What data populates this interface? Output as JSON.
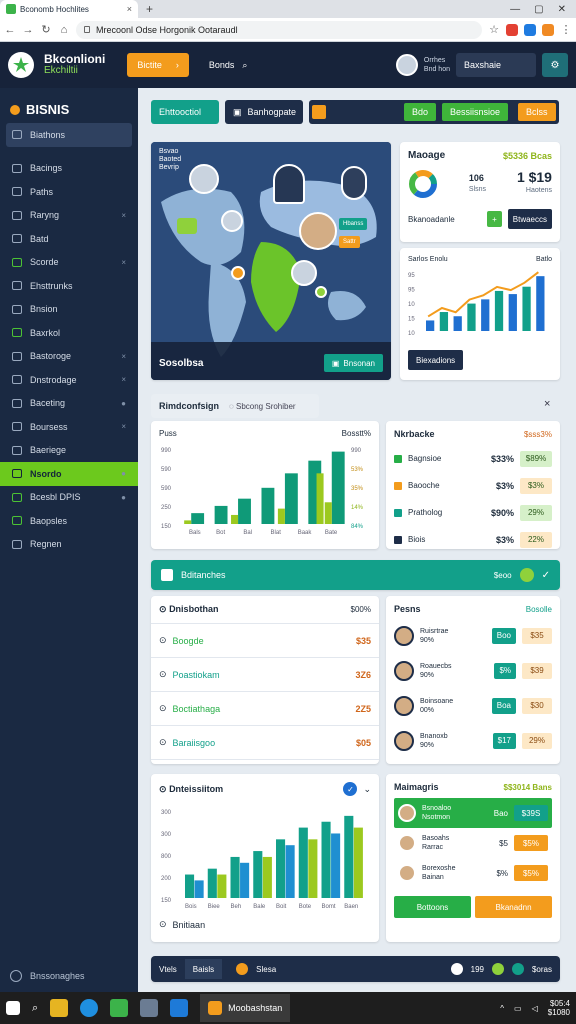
{
  "browser": {
    "tab_title": "Bconomb Hochlites",
    "url": "Mrecoonl Odse Horgonik Ootaraudl",
    "controls": [
      "—",
      "▢",
      "✕"
    ]
  },
  "appbar": {
    "brand_line1": "Bkconlioni",
    "brand_line2": "Ekchiltii",
    "orange_button": "Bictite",
    "nav_link": "Bonds",
    "profile_top": "Orrhes",
    "profile_bottom": "Bnd hon",
    "profile_box": "Baxshaie"
  },
  "sidebar": {
    "header": "BISNIS",
    "items": [
      {
        "label": "Biathons",
        "tail": ""
      },
      {
        "label": "Bacings",
        "tail": ""
      },
      {
        "label": "Paths",
        "tail": ""
      },
      {
        "label": "Raryng",
        "tail": "×"
      },
      {
        "label": "Batd",
        "tail": ""
      },
      {
        "label": "Scorde",
        "tail": "×"
      },
      {
        "label": "Ehsttrunks",
        "tail": ""
      },
      {
        "label": "Bnsion",
        "tail": ""
      },
      {
        "label": "Baxrkol",
        "tail": ""
      },
      {
        "label": "Bastoroge",
        "tail": "×"
      },
      {
        "label": "Dnstrodage",
        "tail": "×"
      },
      {
        "label": "Baceting",
        "tail": "●"
      },
      {
        "label": "Boursess",
        "tail": "×"
      },
      {
        "label": "Baeriege",
        "tail": ""
      },
      {
        "label": "Nsordo",
        "tail": "●"
      },
      {
        "label": "Bcesbl DPIS",
        "tail": "●"
      },
      {
        "label": "Baopsles",
        "tail": ""
      },
      {
        "label": "Regnen",
        "tail": ""
      }
    ],
    "footer": "Bnssonaghes"
  },
  "toolbar": {
    "chip1": "Ehttooctiol",
    "chip2": "Banhogpate",
    "chip3": "Bdo",
    "chip4": "Bessiisnsioe",
    "chip5": "Bclss"
  },
  "map": {
    "top_label_lines": [
      "Bsvao",
      "Baoted",
      "Bevrip"
    ],
    "bottom_label": "Sosolbsa",
    "bottom_button": "Bnsonan",
    "marker_badges": [
      "Hbanss",
      "Sattr"
    ]
  },
  "manage": {
    "title": "Maoage",
    "value": "$5336 Bcas",
    "donut_label1": "106",
    "donut_label2": "Slsns",
    "big_value": "1 $19",
    "big_sub": "Haotens",
    "footer_left": "Bkanoadanle",
    "footer_button": "Btwaeccs",
    "colors": {
      "blue": "#1f6fd1",
      "green": "#47b844",
      "orange": "#f39c1d",
      "teal": "#12a08a"
    }
  },
  "trend": {
    "title": "Sarlos Enolu",
    "right": "Batlo",
    "button": "Biexadions",
    "y_ticks": [
      "95",
      "95",
      "10",
      "15",
      "10"
    ]
  },
  "section": {
    "title": "Rimdconfsign",
    "pill": "Sbcong Srohiber"
  },
  "chart_data": [
    {
      "type": "bar",
      "title": "Puss",
      "value_label": "Bosstt%",
      "categories": [
        "Bals",
        "Bot",
        "Bal",
        "Blat",
        "Baak",
        "Bate"
      ],
      "series": [
        {
          "values": [
            6,
            10,
            14,
            20,
            28,
            35,
            40
          ]
        },
        {
          "values": [
            4,
            7,
            10,
            13,
            17,
            21,
            24
          ]
        }
      ],
      "y_ticks_left": [
        "990",
        "590",
        "590",
        "250",
        "150"
      ],
      "y_ticks_right": [
        "990",
        "53%",
        "35%",
        "14%",
        "84%"
      ]
    },
    {
      "type": "bar",
      "title": "Dnteissiitom",
      "categories": [
        "Bois",
        "Biee",
        "Beh",
        "Bale",
        "Boit",
        "Bote",
        "Bomt",
        "Baen"
      ],
      "series": [
        {
          "values": [
            4,
            5,
            7,
            8,
            10,
            12,
            13,
            14
          ]
        },
        {
          "values": [
            3,
            4,
            6,
            7,
            9,
            10,
            11,
            12
          ]
        }
      ],
      "y_ticks": [
        "300",
        "300",
        "800",
        "200",
        "150"
      ],
      "footer": "Bnitiaan"
    },
    {
      "type": "line",
      "title": "Sarlos Enolu",
      "series": [
        {
          "values": [
            10,
            18,
            14,
            26,
            30,
            38,
            35,
            42,
            52
          ]
        }
      ]
    }
  ],
  "metrics": {
    "title": "Nkrbacke",
    "header_right": "$sss3%",
    "rows": [
      {
        "label": "Bagnsioe",
        "v1": "$33%",
        "v2": "$89%"
      },
      {
        "label": "Baooche",
        "v1": "$3%",
        "v2": "$3%"
      },
      {
        "label": "Pratholog",
        "v1": "$90%",
        "v2": "29%"
      },
      {
        "label": "Biois",
        "v1": "$3%",
        "v2": "22%"
      }
    ]
  },
  "banner": {
    "label": "Bditanches",
    "right": "$eoo"
  },
  "list_left": {
    "title": "Dnisbothan",
    "right": "$00%",
    "rows": [
      {
        "label": "Boogde",
        "value": "$35"
      },
      {
        "label": "Poastiokam",
        "value": "3Z6"
      },
      {
        "label": "Boctiathaga",
        "value": "2Z5"
      },
      {
        "label": "Baraiisgoo",
        "value": "$05"
      }
    ]
  },
  "people": {
    "title": "Pesns",
    "right": "Bosolle",
    "rows": [
      {
        "name": "Ruisrtrae",
        "sub": "90%",
        "v1": "Boo",
        "v2": "$35"
      },
      {
        "name": "Roauecbs",
        "sub": "90%",
        "v1": "$%",
        "v2": "$39"
      },
      {
        "name": "Boinsoane",
        "sub": "00%",
        "v1": "Boa",
        "v2": "$30"
      },
      {
        "name": "Bnanoxb",
        "sub": "90%",
        "v1": "$17",
        "v2": "29%"
      }
    ]
  },
  "managers": {
    "title": "Maimagris",
    "value": "$$3014 Bans",
    "rows": [
      {
        "name": "Bsnoaloo",
        "sub": "Nsotmon",
        "v1": "Bao",
        "v2": "$39S"
      },
      {
        "name": "Basoahs",
        "sub": "Rarrac",
        "v1": "$5",
        "v2": "$5%"
      },
      {
        "name": "Borexoshe",
        "sub": "Bainan",
        "v1": "$%",
        "v2": "$5%"
      }
    ],
    "btn1": "Bottoons",
    "btn2": "Bkanadnn"
  },
  "bottom_strip": {
    "left": "Vtels",
    "box": "Baisls",
    "center": "Slesa",
    "v1": "199",
    "v2": "$oras"
  },
  "taskbar": {
    "app_label": "Moobashstan",
    "time": "$05:4",
    "date": "$1080"
  }
}
